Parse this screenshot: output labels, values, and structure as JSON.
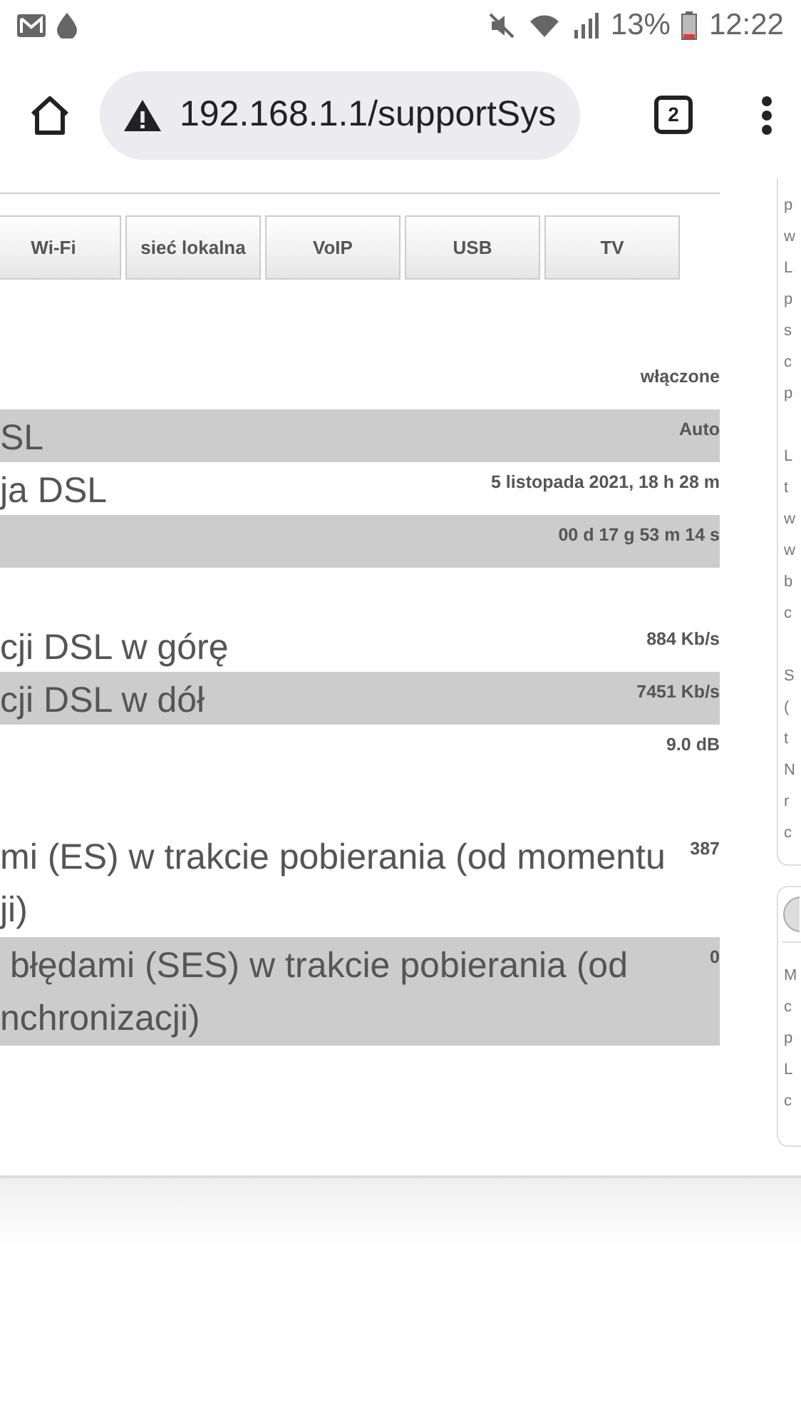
{
  "status_bar": {
    "battery": "13%",
    "time": "12:22"
  },
  "browser": {
    "url": "192.168.1.1/supportSys",
    "tab_count": "2"
  },
  "tabs": [
    {
      "label": "Wi-Fi"
    },
    {
      "label": "sieć lokalna"
    },
    {
      "label": "VoIP"
    },
    {
      "label": "USB"
    },
    {
      "label": "TV"
    }
  ],
  "rows": [
    {
      "kind": "row",
      "value": "włączone",
      "shaded": false
    },
    {
      "kind": "row",
      "label": "SL",
      "value": "Auto",
      "shaded": true
    },
    {
      "kind": "row",
      "label": "ja DSL",
      "value": "5 listopada 2021, 18 h 28 m",
      "shaded": false
    },
    {
      "kind": "row",
      "value": "00 d 17 g 53 m 14 s",
      "shaded": true
    },
    {
      "kind": "gap"
    },
    {
      "kind": "row",
      "label": "cji DSL w górę",
      "value": "884 Kb/s",
      "shaded": false
    },
    {
      "kind": "row",
      "label": "cji DSL w dół",
      "value": "7451 Kb/s",
      "shaded": true
    },
    {
      "kind": "row",
      "value": "9.0 dB",
      "shaded": false
    },
    {
      "kind": "gap"
    },
    {
      "kind": "row",
      "label": "mi (ES) w trakcie pobierania (od momentu\nji)",
      "value": "387",
      "shaded": false
    },
    {
      "kind": "row",
      "label": " błędami (SES) w trakcie pobierania (od\nnchronizacji)",
      "value": "0",
      "shaded": true
    }
  ],
  "sidebar": {
    "cards": [
      {
        "kind": "text",
        "paragraphs": [
          [
            "p",
            "w",
            "L",
            "p",
            "s",
            "c",
            "p"
          ],
          [
            "L",
            "t",
            "w",
            "w",
            "b",
            "c"
          ],
          [
            "S",
            "(",
            "t",
            "N",
            "r",
            "c"
          ]
        ]
      },
      {
        "kind": "icon-text",
        "paragraphs": [
          [
            "M",
            "c",
            "p",
            "L",
            "c"
          ]
        ]
      }
    ]
  }
}
